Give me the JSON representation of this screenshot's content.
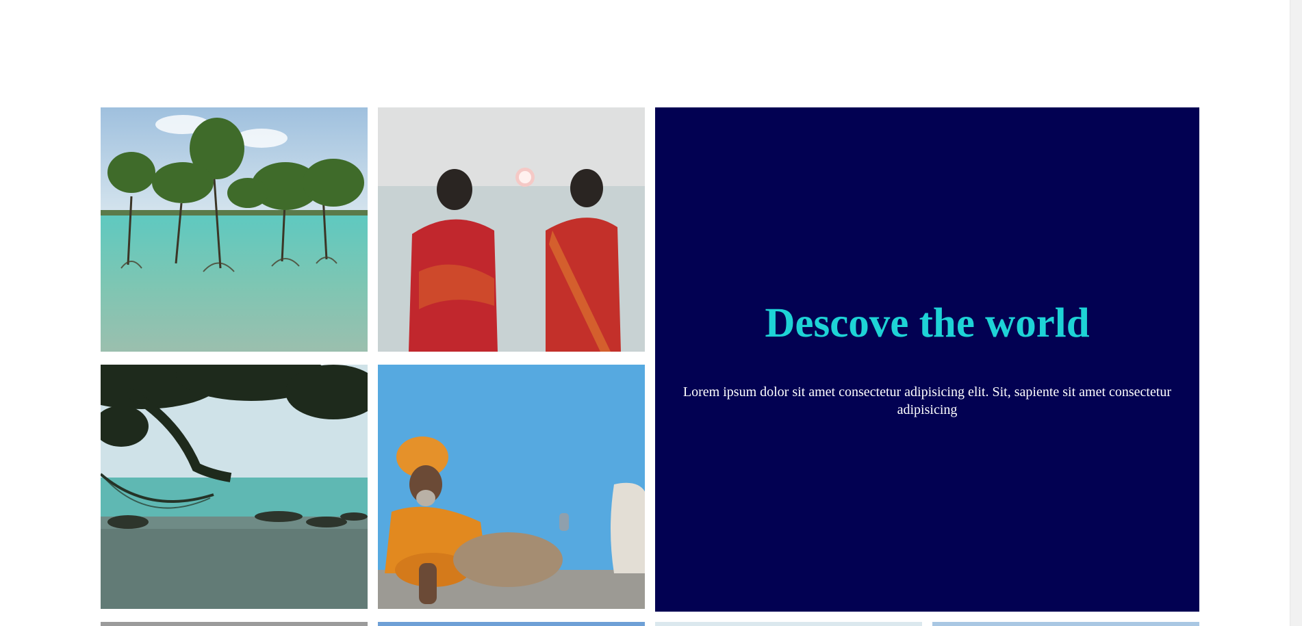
{
  "hero": {
    "title": "Descove the world",
    "text": "Lorem ipsum dolor sit amet consectetur adipisicing elit. Sit, sapiente sit amet consectetur adipisicing",
    "background_color": "#020152",
    "title_color": "#1ed3d6"
  },
  "gallery": [
    {
      "name": "mangrove-trees-photo"
    },
    {
      "name": "women-watching-sunset-photo"
    },
    {
      "name": "beach-hammock-photo"
    },
    {
      "name": "man-blue-wall-photo"
    }
  ]
}
